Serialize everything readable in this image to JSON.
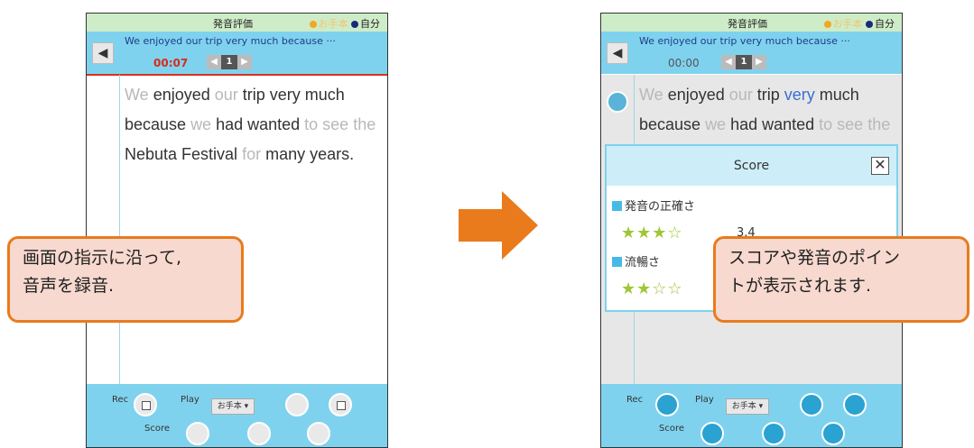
{
  "left_phone": {
    "header_title": "発音評価",
    "mode_label_model": "お手本",
    "mode_label_self": "自分",
    "sentence": "We enjoyed our trip very much because ···",
    "time": "00:07",
    "page": "1",
    "bottom": {
      "rec": "Rec",
      "play": "Play",
      "select": "お手本 ▾",
      "score": "Score"
    }
  },
  "right_phone": {
    "header_title": "発音評価",
    "mode_label_model": "お手本",
    "mode_label_self": "自分",
    "sentence": "We enjoyed our trip very much because ···",
    "time": "00:00",
    "page": "1",
    "bottom": {
      "rec": "Rec",
      "play": "Play",
      "select": "お手本 ▾",
      "score": "Score"
    }
  },
  "score_popup": {
    "title": "Score",
    "close": "✕",
    "section1": "発音の正確さ",
    "stars1": "★★★☆",
    "value1": "3.4",
    "section2": "流暢さ",
    "stars2": "★★☆☆"
  },
  "callout_left": {
    "line1": "画面の指示に沿って,",
    "line2": "音声を録音."
  },
  "callout_right": {
    "line1": "スコアや発音のポイン",
    "line2": "トが表示されます."
  },
  "colors": {
    "accent_blue": "#7fd2ee",
    "arrow_orange": "#e97b1d",
    "callout_bg": "#f7d9cf",
    "record_red": "#d92a1a"
  }
}
